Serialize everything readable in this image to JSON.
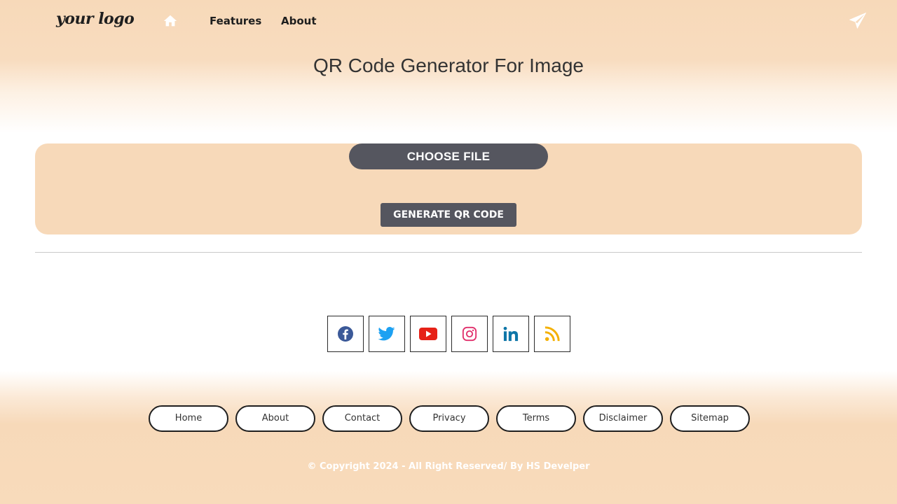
{
  "header": {
    "logo_text": "your logo",
    "nav": {
      "home_icon": "home-icon",
      "features_label": "Features",
      "about_label": "About",
      "send_icon": "paper-plane-icon"
    },
    "title": "QR Code Generator For Image"
  },
  "upload": {
    "choose_label": "CHOOSE FILE",
    "generate_label": "GENERATE QR CODE"
  },
  "social": [
    {
      "name": "facebook-icon",
      "color": "#3b5998"
    },
    {
      "name": "twitter-icon",
      "color": "#1da1f2"
    },
    {
      "name": "youtube-icon",
      "color": "#e62117"
    },
    {
      "name": "instagram-icon",
      "color": "#e1306c"
    },
    {
      "name": "linkedin-icon",
      "color": "#0e76a8"
    },
    {
      "name": "rss-icon",
      "color": "#f4b000"
    }
  ],
  "footer": {
    "links": [
      "Home",
      "About",
      "Contact",
      "Privacy",
      "Terms",
      "Disclaimer",
      "Sitemap"
    ],
    "copyright": "© Copyright 2024 - All Right Reserved/ By HS Develper"
  },
  "colors": {
    "accent_peach": "#f7d9b9",
    "button_dark": "#55565f"
  }
}
